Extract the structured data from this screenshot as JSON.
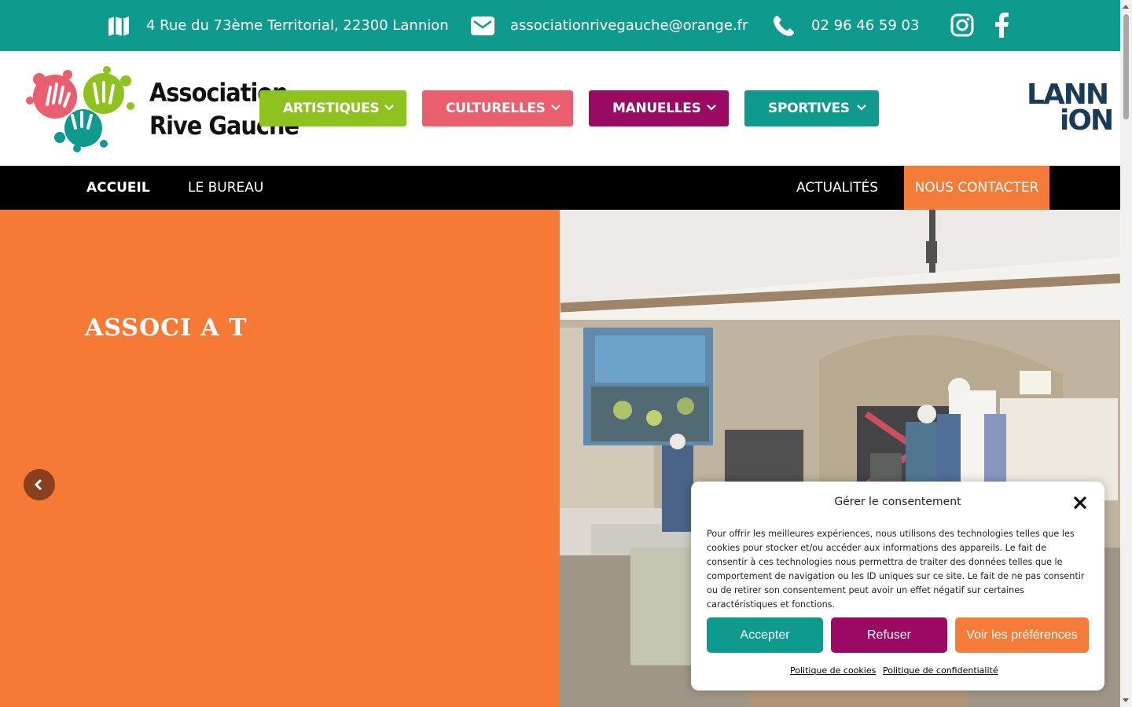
{
  "topbar": {
    "address": "4 Rue du 73ème Territorial, 22300 Lannion",
    "email": "associationrivegauche@orange.fr",
    "phone": "02 96 46 59 03",
    "icons": [
      "map-icon",
      "mail-icon",
      "phone-icon",
      "instagram-icon",
      "facebook-icon"
    ],
    "bg_color": "#0e9b8d"
  },
  "logo": {
    "line1": "Association",
    "line2": "Rive Gauche",
    "partner_logo_line1": "LANN",
    "partner_logo_line2": "iON"
  },
  "categories": [
    {
      "label": "ARTISTIQUES",
      "color": "#8dc21f"
    },
    {
      "label": "CULTURELLES",
      "color": "#ea5f6e"
    },
    {
      "label": "MANUELLES",
      "color": "#9b0a62"
    },
    {
      "label": "SPORTIVES",
      "color": "#0e9b8d"
    }
  ],
  "nav": {
    "home": "ACCUEIL",
    "bureau": "LE BUREAU",
    "news": "ACTUALITÉS",
    "contact": "NOUS CONTACTER",
    "contact_color": "#f57b38"
  },
  "hero": {
    "title_partial": "ASSOCI A  T  ",
    "bg_color": "#f67a36"
  },
  "consent": {
    "title": "Gérer le consentement",
    "body": "Pour offrir les meilleures expériences, nous utilisons des technologies telles que les cookies pour stocker et/ou accéder aux informations des appareils. Le fait de consentir à ces technologies nous permettra de traiter des données telles que le comportement de navigation ou les ID uniques sur ce site. Le fait de ne pas consentir ou de retirer son consentement peut avoir un effet négatif sur certaines caractéristiques et fonctions.",
    "accept": "Accepter",
    "refuse": "Refuser",
    "preferences": "Voir les préférences",
    "cookie_policy": "Politique de cookies",
    "privacy_policy": "Politique de confidentialité",
    "accept_color": "#0e9b8d",
    "refuse_color": "#9b0a62",
    "preferences_color": "#f57b38"
  }
}
